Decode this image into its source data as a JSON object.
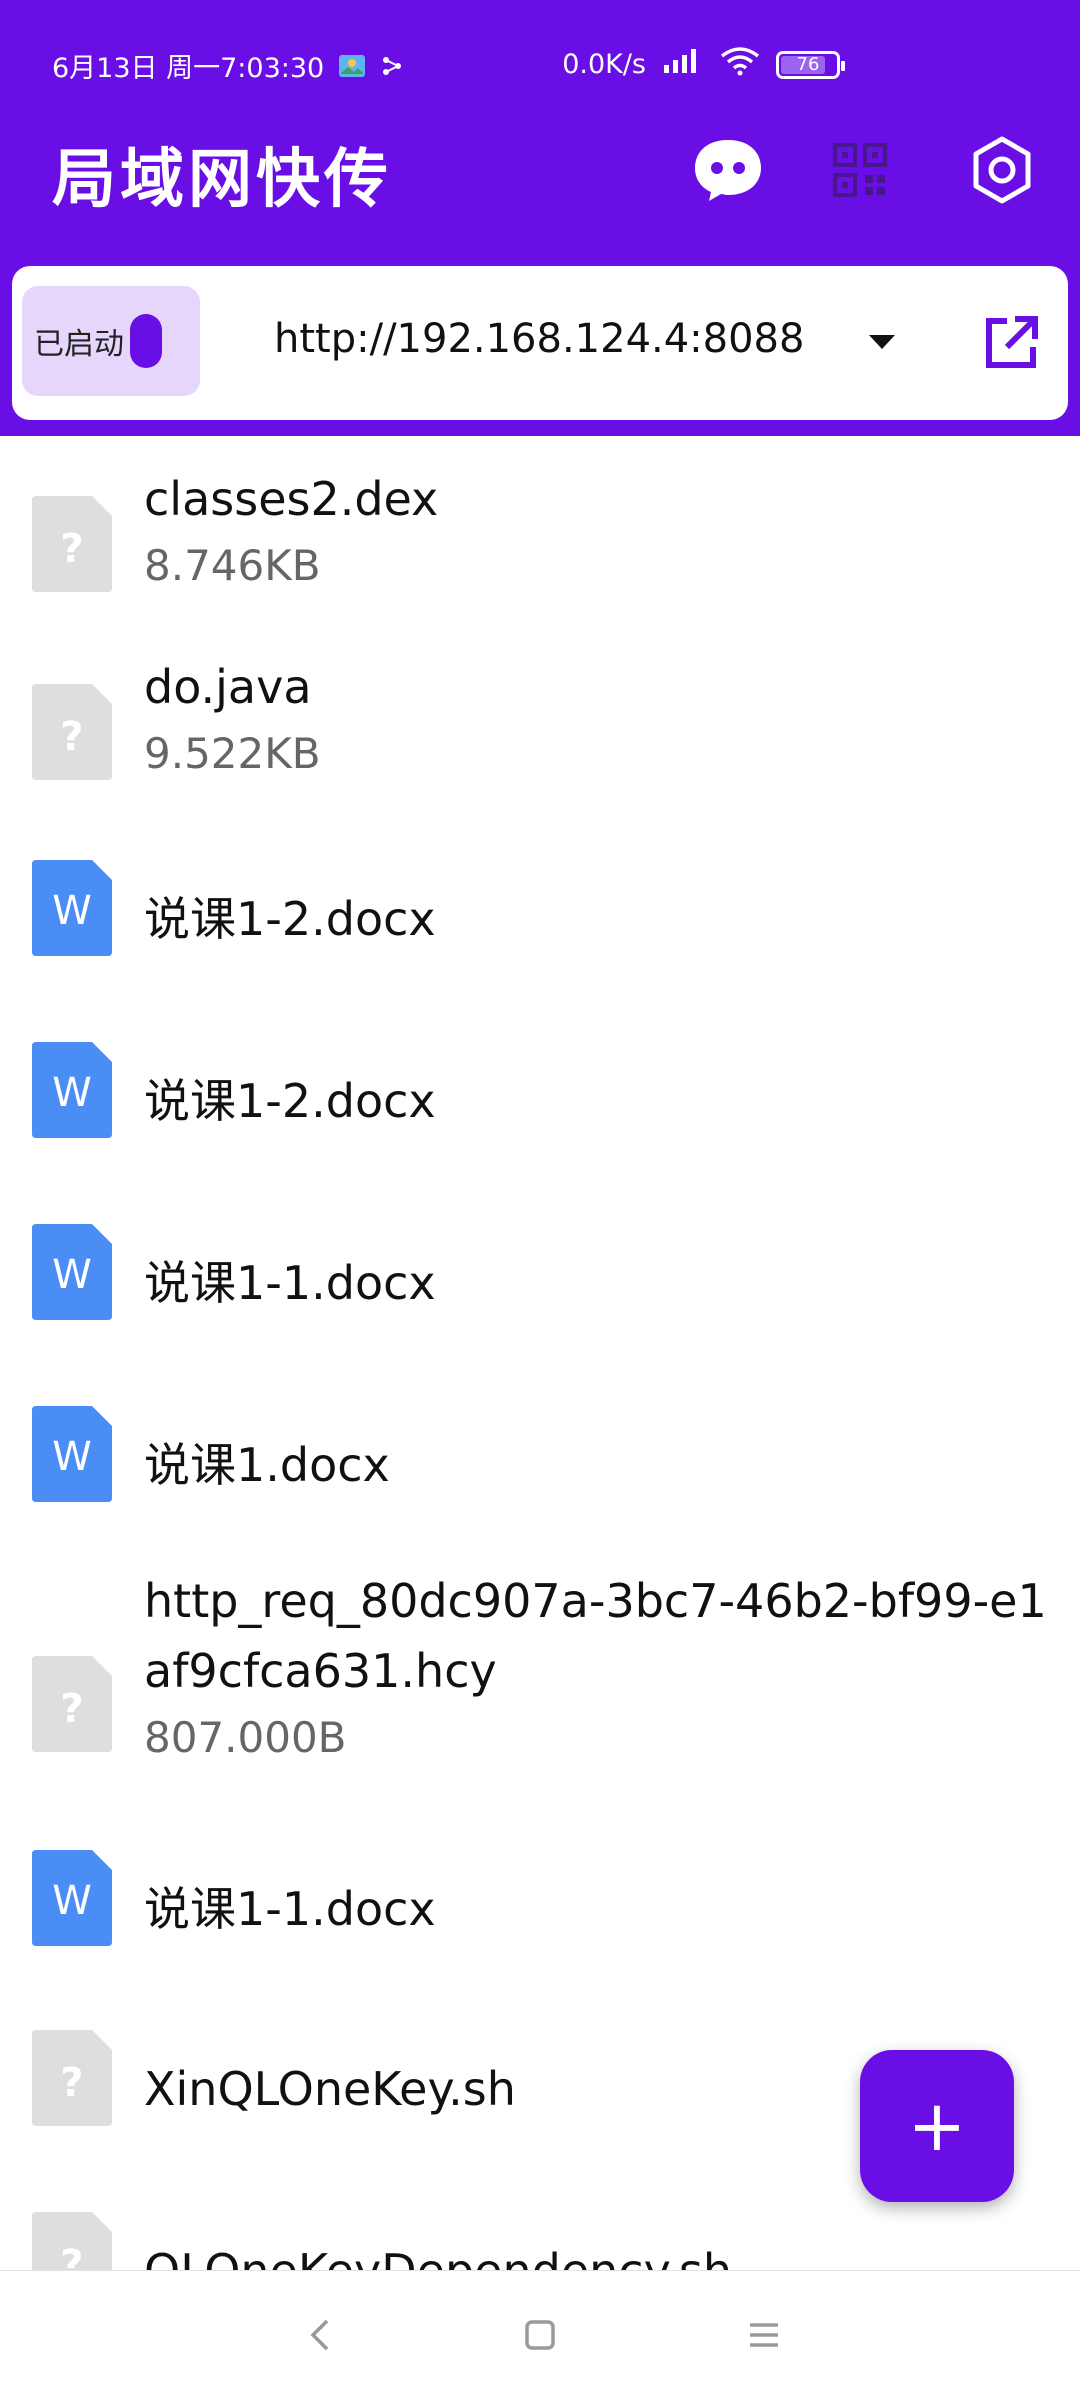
{
  "status_bar": {
    "datetime": "6月13日 周一7:03:30",
    "net_speed": "0.0K/s",
    "battery": "76"
  },
  "app_bar": {
    "title": "局域网快传",
    "icons": [
      "chat-icon",
      "qr-code-icon",
      "settings-icon"
    ]
  },
  "server": {
    "toggle_label": "已启动",
    "toggle_on": true,
    "url": "http://192.168.124.4:8088"
  },
  "files": [
    {
      "name": "classes2.dex",
      "size": "8.746KB",
      "type": "unknown"
    },
    {
      "name": "do.java",
      "size": "9.522KB",
      "type": "unknown"
    },
    {
      "name": "说课1-2.docx",
      "size": "",
      "type": "word"
    },
    {
      "name": "说课1-2.docx",
      "size": "",
      "type": "word"
    },
    {
      "name": "说课1-1.docx",
      "size": "",
      "type": "word"
    },
    {
      "name": "说课1.docx",
      "size": "",
      "type": "word"
    },
    {
      "name": "http_req_80dc907a-3bc7-46b2-bf99-e1af9cfca631.hcy",
      "size": "807.000B",
      "type": "unknown"
    },
    {
      "name": "说课1-1.docx",
      "size": "",
      "type": "word"
    },
    {
      "name": "XinQLOneKey.sh",
      "size": "",
      "type": "unknown"
    },
    {
      "name": "QLOneKeyDependency.sh",
      "size": "",
      "type": "unknown"
    }
  ],
  "fab": {
    "label": "+"
  },
  "colors": {
    "primary": "#6a0ee6",
    "toggle_bg": "#e6d6fb",
    "word_icon": "#4a8ef5",
    "unknown_icon": "#dedede"
  }
}
